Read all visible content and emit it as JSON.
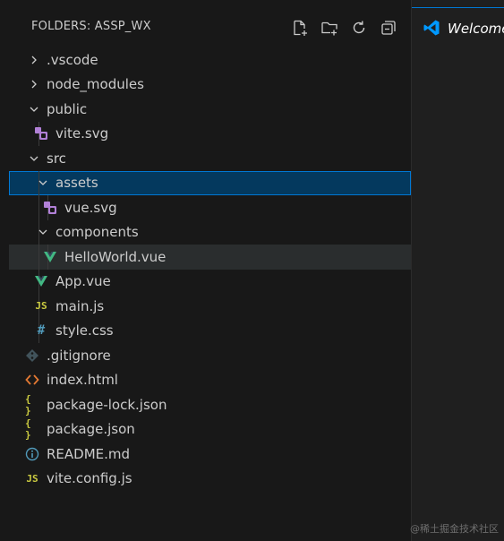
{
  "explorer": {
    "title": "FOLDERS: ASSP_WX",
    "actions": [
      {
        "name": "new-file-icon"
      },
      {
        "name": "new-folder-icon"
      },
      {
        "name": "refresh-icon"
      },
      {
        "name": "collapse-all-icon"
      }
    ]
  },
  "tree": [
    {
      "label": ".vscode",
      "type": "folder",
      "state": "collapsed",
      "depth": 0
    },
    {
      "label": "node_modules",
      "type": "folder",
      "state": "collapsed",
      "depth": 0
    },
    {
      "label": "public",
      "type": "folder",
      "state": "expanded",
      "depth": 0
    },
    {
      "label": "vite.svg",
      "type": "file",
      "icon": "svg-icon",
      "depth": 1
    },
    {
      "label": "src",
      "type": "folder",
      "state": "expanded",
      "depth": 0
    },
    {
      "label": "assets",
      "type": "folder",
      "state": "expanded",
      "depth": 1,
      "selected": true
    },
    {
      "label": "vue.svg",
      "type": "file",
      "icon": "svg-icon",
      "depth": 2
    },
    {
      "label": "components",
      "type": "folder",
      "state": "expanded",
      "depth": 1
    },
    {
      "label": "HelloWorld.vue",
      "type": "file",
      "icon": "vue-icon",
      "depth": 2,
      "hovered": true
    },
    {
      "label": "App.vue",
      "type": "file",
      "icon": "vue-icon",
      "depth": 1
    },
    {
      "label": "main.js",
      "type": "file",
      "icon": "js-icon",
      "depth": 1
    },
    {
      "label": "style.css",
      "type": "file",
      "icon": "css-icon",
      "depth": 1
    },
    {
      "label": ".gitignore",
      "type": "file",
      "icon": "git-icon",
      "depth": 0
    },
    {
      "label": "index.html",
      "type": "file",
      "icon": "html-icon",
      "depth": 0
    },
    {
      "label": "package-lock.json",
      "type": "file",
      "icon": "json-icon",
      "depth": 0
    },
    {
      "label": "package.json",
      "type": "file",
      "icon": "json-icon",
      "depth": 0
    },
    {
      "label": "README.md",
      "type": "file",
      "icon": "info-icon",
      "depth": 0
    },
    {
      "label": "vite.config.js",
      "type": "file",
      "icon": "js-icon",
      "depth": 0
    }
  ],
  "icon_text": {
    "js": "JS",
    "css": "#",
    "json": "{ }",
    "html": "<>",
    "info": "i"
  },
  "editor": {
    "tab_label": "Welcome"
  },
  "watermark": "@稀土掘金技术社区",
  "colors": {
    "background": "#181818",
    "selection": "#04395e",
    "selection_border": "#0078d4",
    "hover": "#2a2d2e",
    "text": "#cccccc",
    "vue": "#42b883",
    "svg": "#b180d7",
    "js": "#cbcb41",
    "css": "#519aba",
    "html": "#e37933",
    "json": "#cbcb41",
    "info": "#519aba",
    "git": "#41535b",
    "vscode_blue": "#0098ff"
  }
}
